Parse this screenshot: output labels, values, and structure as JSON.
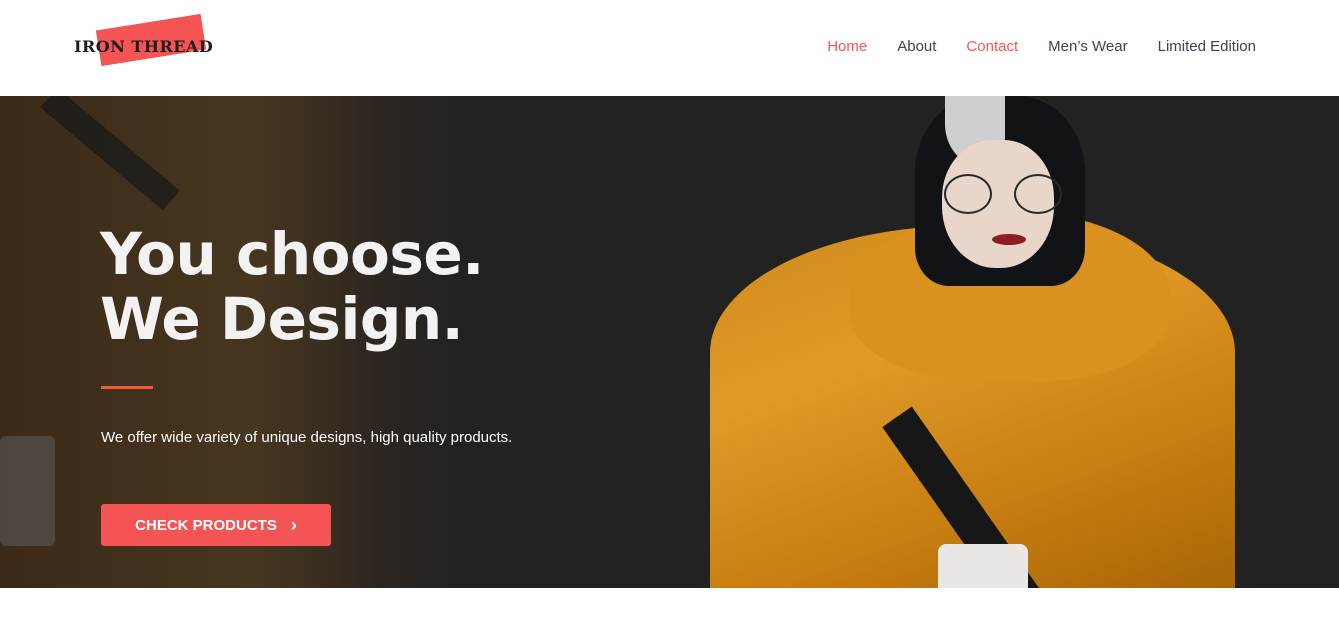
{
  "brand": {
    "name": "IRON THREAD",
    "accent_color": "#f55454"
  },
  "nav": {
    "items": [
      {
        "label": "Home",
        "active": true
      },
      {
        "label": "About",
        "active": false
      },
      {
        "label": "Contact",
        "active": true
      },
      {
        "label": "Men’s Wear",
        "active": false
      },
      {
        "label": "Limited Edition",
        "active": false
      }
    ]
  },
  "hero": {
    "title_line1": "You choose.",
    "title_line2": "We Design.",
    "subtitle": "We offer wide variety of unique designs, high quality products.",
    "cta_label": "CHECK PRODUCTS",
    "cta_icon": "chevron-right-icon",
    "background_color": "#222222",
    "image": "model-in-orange-jacket"
  }
}
